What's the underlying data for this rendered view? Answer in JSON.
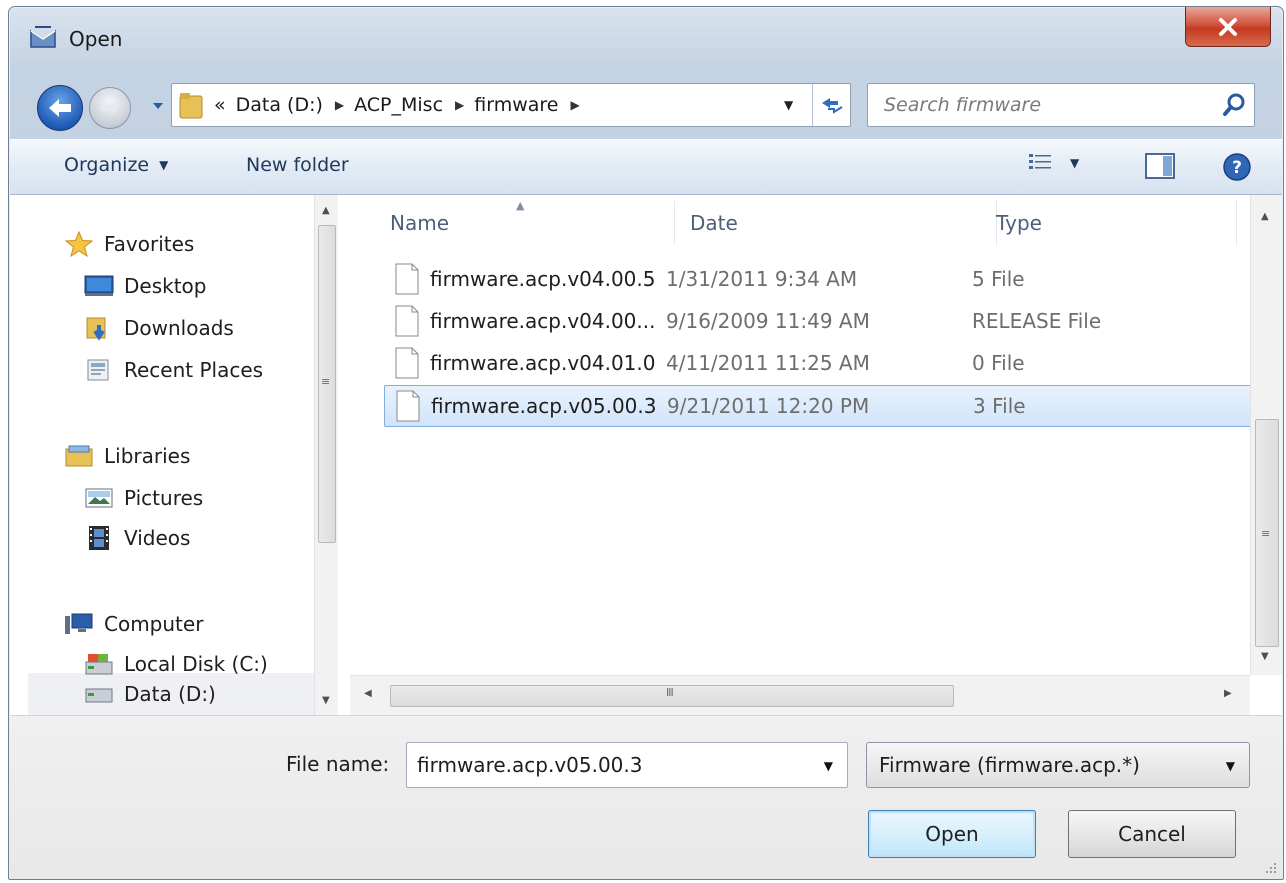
{
  "window": {
    "title": "Open"
  },
  "nav": {
    "breadcrumb_overflow": "«",
    "breadcrumbs": [
      "Data (D:)",
      "ACP_Misc",
      "firmware"
    ],
    "search_placeholder": "Search firmware"
  },
  "toolbar": {
    "organize_label": "Organize",
    "new_folder_label": "New folder"
  },
  "sidebar": {
    "favorites": {
      "label": "Favorites",
      "icon": "star-icon"
    },
    "favorite_items": [
      {
        "label": "Desktop",
        "icon": "desktop-icon"
      },
      {
        "label": "Downloads",
        "icon": "downloads-icon"
      },
      {
        "label": "Recent Places",
        "icon": "recent-places-icon"
      }
    ],
    "libraries": {
      "label": "Libraries",
      "icon": "libraries-icon"
    },
    "library_items": [
      {
        "label": "Pictures",
        "icon": "pictures-icon"
      },
      {
        "label": "Videos",
        "icon": "videos-icon"
      }
    ],
    "computer": {
      "label": "Computer",
      "icon": "computer-icon"
    },
    "computer_items": [
      {
        "label": "Local Disk (C:)",
        "icon": "local-disk-icon"
      },
      {
        "label": "Data (D:)",
        "icon": "drive-icon",
        "selected": true
      }
    ]
  },
  "files": {
    "columns": [
      "Name",
      "Date",
      "Type"
    ],
    "rows": [
      {
        "name": "firmware.acp.v04.00.5",
        "date": "1/31/2011 9:34 AM",
        "type": "5 File",
        "selected": false
      },
      {
        "name": "firmware.acp.v04.00...",
        "date": "9/16/2009 11:49 AM",
        "type": "RELEASE File",
        "selected": false
      },
      {
        "name": "firmware.acp.v04.01.0",
        "date": "4/11/2011 11:25 AM",
        "type": "0 File",
        "selected": false
      },
      {
        "name": "firmware.acp.v05.00.3",
        "date": "9/21/2011 12:20 PM",
        "type": "3 File",
        "selected": true
      }
    ]
  },
  "bottom": {
    "file_name_label": "File name:",
    "file_name_value": "firmware.acp.v05.00.3",
    "filter_value": "Firmware (firmware.acp.*)",
    "open_label": "Open",
    "cancel_label": "Cancel"
  },
  "colors": {
    "selection": "#d1e4fa",
    "selection_border": "#84acdd",
    "header_text": "#4c607a",
    "close_button": "#c23a22"
  }
}
